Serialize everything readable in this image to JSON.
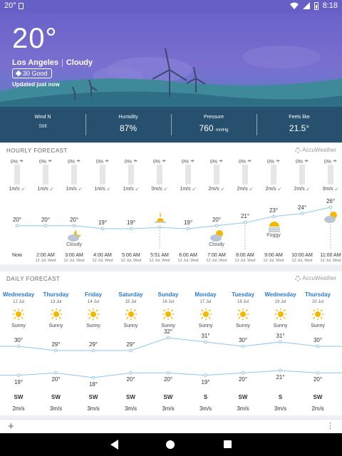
{
  "status_bar": {
    "temp": "20°",
    "time": "8:18"
  },
  "current": {
    "temp": "20°",
    "city": "Los Angeles",
    "condition": "Cloudy",
    "aqi": "30 Good",
    "updated": "Updated just now"
  },
  "stats": [
    {
      "label": "Wind N",
      "value": "Still",
      "unit": ""
    },
    {
      "label": "Humidity",
      "value": "87%",
      "unit": ""
    },
    {
      "label": "Pressure",
      "value": "760",
      "unit": "mmHg"
    },
    {
      "label": "Feels like",
      "value": "21.5°",
      "unit": ""
    }
  ],
  "hourly": {
    "title": "HOURLY FORECAST",
    "provider": "AccuWeather",
    "hours": [
      {
        "precip": "0%",
        "wind": "1m/s",
        "temp": "20°",
        "time": "Now",
        "date": "",
        "icon": "",
        "label": ""
      },
      {
        "precip": "0%",
        "wind": "1m/s",
        "temp": "20°",
        "time": "2:00 AM",
        "date": "12 Jul, Wed",
        "icon": "",
        "label": ""
      },
      {
        "precip": "0%",
        "wind": "1m/s",
        "temp": "20°",
        "time": "3:00 AM",
        "date": "12 Jul, Wed",
        "icon": "cloudy-night",
        "label": "Cloudy"
      },
      {
        "precip": "0%",
        "wind": "1m/s",
        "temp": "19°",
        "time": "4:00 AM",
        "date": "12 Jul, Wed",
        "icon": "",
        "label": ""
      },
      {
        "precip": "0%",
        "wind": "1m/s",
        "temp": "19°",
        "time": "5:00 AM",
        "date": "12 Jul, Wed",
        "icon": "",
        "label": ""
      },
      {
        "precip": "0%",
        "wind": "0m/s",
        "temp": "",
        "time": "5:51 AM",
        "date": "12 Jul, Wed",
        "icon": "sunrise",
        "label": ""
      },
      {
        "precip": "0%",
        "wind": "1m/s",
        "temp": "19°",
        "time": "6:00 AM",
        "date": "12 Jul, Wed",
        "icon": "",
        "label": ""
      },
      {
        "precip": "0%",
        "wind": "2m/s",
        "temp": "20°",
        "time": "7:00 AM",
        "date": "12 Jul, Wed",
        "icon": "cloudy-day",
        "label": "Cloudy"
      },
      {
        "precip": "0%",
        "wind": "2m/s",
        "temp": "21°",
        "time": "8:00 AM",
        "date": "12 Jul, Wed",
        "icon": "",
        "label": ""
      },
      {
        "precip": "0%",
        "wind": "2m/s",
        "temp": "23°",
        "time": "9:00 AM",
        "date": "12 Jul, Wed",
        "icon": "foggy",
        "label": "Foggy"
      },
      {
        "precip": "0%",
        "wind": "2m/s",
        "temp": "24°",
        "time": "10:00 AM",
        "date": "12 Jul, Wed",
        "icon": "",
        "label": ""
      },
      {
        "precip": "0%",
        "wind": "3m/s",
        "temp": "26°",
        "time": "11:00 AM",
        "date": "12 Jul, Wed",
        "icon": "cloudy-day",
        "label": ""
      }
    ]
  },
  "daily": {
    "title": "DAILY FORECAST",
    "provider": "AccuWeather",
    "days": [
      {
        "name": "Wednesday",
        "date": "12 Jul",
        "cond": "Sunny",
        "high": "30°",
        "low": "19°",
        "dir": "SW",
        "speed": "2m/s"
      },
      {
        "name": "Thursday",
        "date": "13 Jul",
        "cond": "Sunny",
        "high": "29°",
        "low": "20°",
        "dir": "SW",
        "speed": "3m/s"
      },
      {
        "name": "Friday",
        "date": "14 Jul",
        "cond": "Sunny",
        "high": "29°",
        "low": "18°",
        "dir": "SW",
        "speed": "3m/s"
      },
      {
        "name": "Saturday",
        "date": "15 Jul",
        "cond": "Sunny",
        "high": "29°",
        "low": "20°",
        "dir": "SW",
        "speed": "3m/s"
      },
      {
        "name": "Sunday",
        "date": "16 Jul",
        "cond": "Sunny",
        "high": "32°",
        "low": "20°",
        "dir": "SW",
        "speed": "3m/s"
      },
      {
        "name": "Monday",
        "date": "17 Jul",
        "cond": "Sunny",
        "high": "31°",
        "low": "19°",
        "dir": "S",
        "speed": "3m/s"
      },
      {
        "name": "Tuesday",
        "date": "18 Jul",
        "cond": "Sunny",
        "high": "30°",
        "low": "20°",
        "dir": "SW",
        "speed": "3m/s"
      },
      {
        "name": "Wednesday",
        "date": "19 Jul",
        "cond": "Sunny",
        "high": "31°",
        "low": "21°",
        "dir": "S",
        "speed": "3m/s"
      },
      {
        "name": "Thursday",
        "date": "20 Jul",
        "cond": "Sunny",
        "high": "30°",
        "low": "20°",
        "dir": "SW",
        "speed": "2m/s"
      }
    ]
  },
  "colors": {
    "accent": "#2a7bd1",
    "sun": "#f5b800",
    "hero": "#6962c8"
  }
}
